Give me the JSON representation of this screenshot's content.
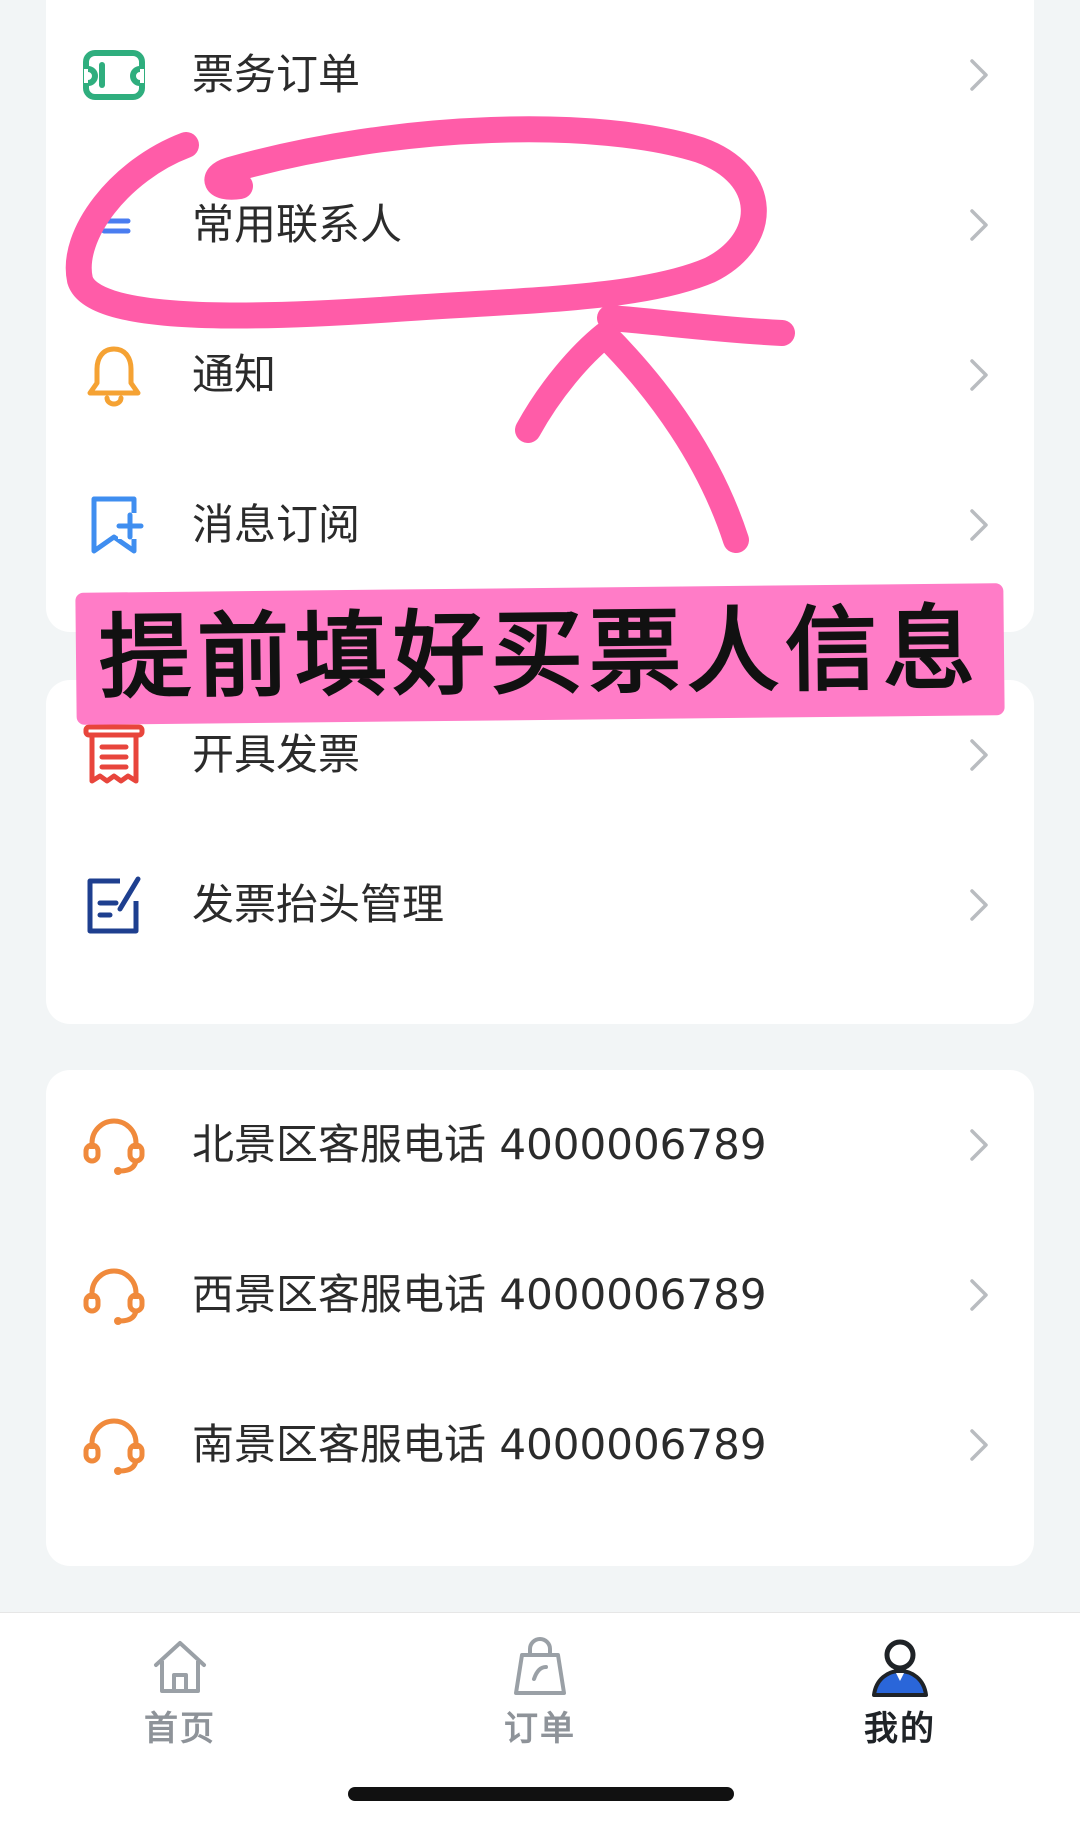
{
  "menu_group_1": [
    {
      "label": "票务订单",
      "icon": "ticket-icon"
    },
    {
      "label": "常用联系人",
      "icon": "contacts-icon"
    },
    {
      "label": "通知",
      "icon": "bell-icon"
    },
    {
      "label": "消息订阅",
      "icon": "bookmark-add-icon"
    }
  ],
  "menu_group_2": [
    {
      "label": "开具发票",
      "icon": "receipt-icon"
    },
    {
      "label": "发票抬头管理",
      "icon": "edit-document-icon"
    }
  ],
  "menu_group_3": [
    {
      "label": "北景区客服电话 4000006789",
      "icon": "headset-icon"
    },
    {
      "label": "西景区客服电话 4000006789",
      "icon": "headset-icon"
    },
    {
      "label": "南景区客服电话 4000006789",
      "icon": "headset-icon"
    }
  ],
  "annotation": {
    "text": "提前填好买票人信息",
    "highlight_color": "#ff7cc7",
    "stroke_color": "#ff5ca8"
  },
  "tabbar": {
    "tabs": [
      {
        "label": "首页",
        "icon": "home-icon",
        "active": false
      },
      {
        "label": "订单",
        "icon": "shopping-bag-icon",
        "active": false
      },
      {
        "label": "我的",
        "icon": "user-icon",
        "active": true
      }
    ]
  },
  "colors": {
    "page_background": "#f2f5f6",
    "ticket_icon": "#2fae7e",
    "contacts_icon": "#4a7df0",
    "bell_icon": "#f5a233",
    "bookmark_icon": "#3f8ef0",
    "receipt_icon": "#e8453c",
    "edit_icon": "#1e3f8f",
    "headset_icon": "#f08a3c",
    "active_tab": "#2a66d9"
  }
}
